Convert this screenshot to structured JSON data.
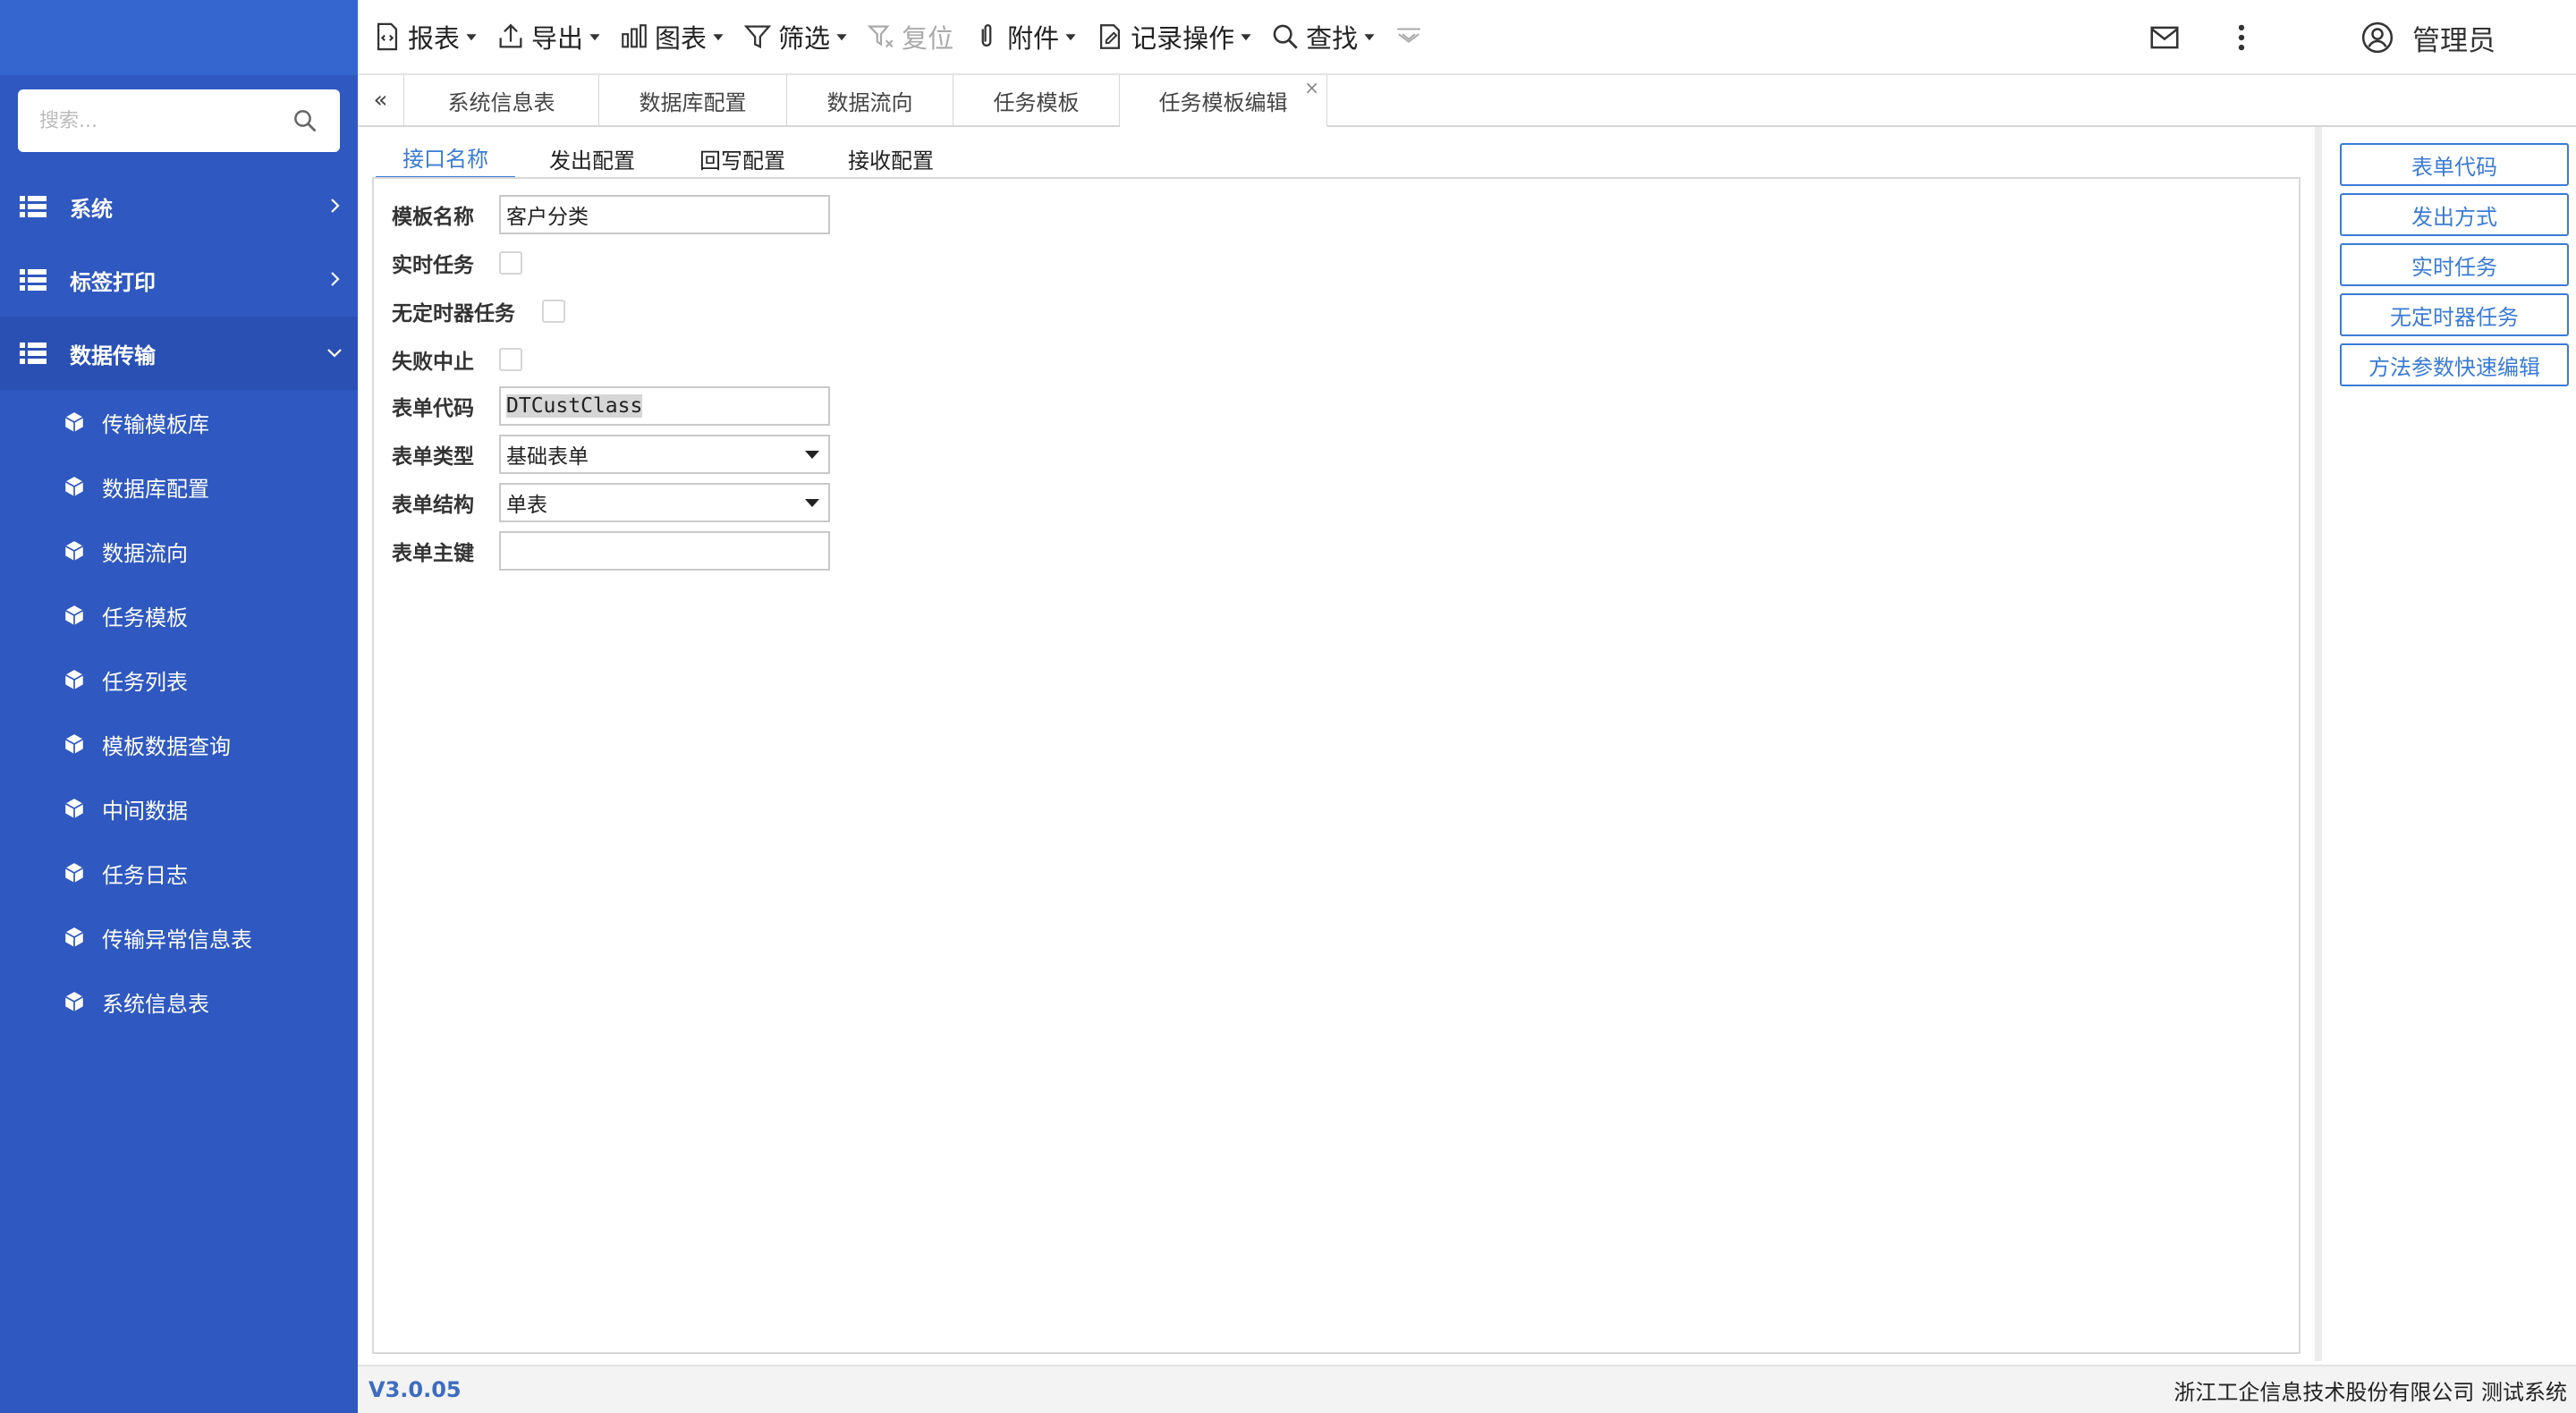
{
  "toolbar": {
    "items": [
      {
        "label": "报表",
        "icon": "report-icon",
        "caret": true,
        "disabled": false
      },
      {
        "label": "导出",
        "icon": "export-icon",
        "caret": true,
        "disabled": false
      },
      {
        "label": "图表",
        "icon": "chart-icon",
        "caret": true,
        "disabled": false
      },
      {
        "label": "筛选",
        "icon": "filter-icon",
        "caret": true,
        "disabled": false
      },
      {
        "label": "复位",
        "icon": "filter-reset-icon",
        "caret": false,
        "disabled": true
      },
      {
        "label": "附件",
        "icon": "paperclip-icon",
        "caret": true,
        "disabled": false
      },
      {
        "label": "记录操作",
        "icon": "record-edit-icon",
        "caret": true,
        "disabled": false
      },
      {
        "label": "查找",
        "icon": "search-icon",
        "caret": true,
        "disabled": false
      }
    ],
    "user_name": "管理员"
  },
  "sidebar": {
    "search_placeholder": "搜索...",
    "groups": [
      {
        "label": "系统",
        "open": false
      },
      {
        "label": "标签打印",
        "open": false
      },
      {
        "label": "数据传输",
        "open": true
      }
    ],
    "items": [
      "传输模板库",
      "数据库配置",
      "数据流向",
      "任务模板",
      "任务列表",
      "模板数据查询",
      "中间数据",
      "任务日志",
      "传输异常信息表",
      "系统信息表"
    ]
  },
  "page_tabs": {
    "collapse_label": "«",
    "tabs": [
      "系统信息表",
      "数据库配置",
      "数据流向",
      "任务模板",
      "任务模板编辑"
    ],
    "active_index": 4,
    "close_label": "×"
  },
  "inner_tabs": {
    "tabs": [
      "接口名称",
      "发出配置",
      "回写配置",
      "接收配置"
    ],
    "active_index": 0
  },
  "form": {
    "template_name_label": "模板名称",
    "template_name_value": "客户分类",
    "realtime_task_label": "实时任务",
    "no_timer_task_label": "无定时器任务",
    "fail_abort_label": "失败中止",
    "form_code_label": "表单代码",
    "form_code_value": "DTCustClass",
    "form_type_label": "表单类型",
    "form_type_value": "基础表单",
    "form_structure_label": "表单结构",
    "form_structure_value": "单表",
    "form_key_label": "表单主键",
    "form_key_value": ""
  },
  "side_buttons": [
    "表单代码",
    "发出方式",
    "实时任务",
    "无定时器任务",
    "方法参数快速编辑"
  ],
  "footer": {
    "version": "V3.0.05",
    "company": "浙江工企信息技术股份有限公司 测试系统"
  },
  "colors": {
    "sidebar_bg": "#2f58c0",
    "accent": "#3a7bd5",
    "version_text": "#3d6cc0"
  }
}
